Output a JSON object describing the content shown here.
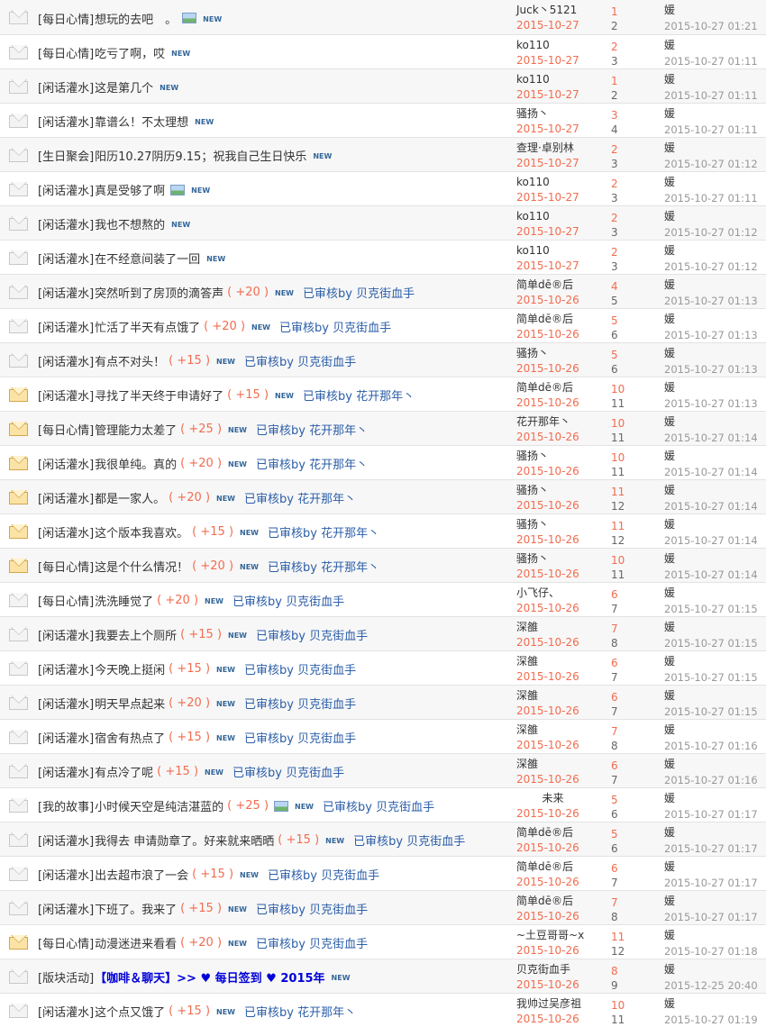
{
  "new_label": "NEW",
  "threads": [
    {
      "category": "[每日心情]",
      "subject": "想玩的去吧　。",
      "credit": "",
      "pic": true,
      "audit": "",
      "hot": false,
      "bold": false,
      "author": "Juck丶5121",
      "date": "2015-10-27",
      "replies": "1",
      "views": "2",
      "last_user": "媛",
      "last_time": "2015-10-27 01:21"
    },
    {
      "category": "[每日心情]",
      "subject": "吃亏了啊，哎",
      "credit": "",
      "pic": false,
      "audit": "",
      "hot": false,
      "bold": false,
      "author": "ko110",
      "date": "2015-10-27",
      "replies": "2",
      "views": "3",
      "last_user": "媛",
      "last_time": "2015-10-27 01:11"
    },
    {
      "category": "[闲话灌水]",
      "subject": "这是第几个",
      "credit": "",
      "pic": false,
      "audit": "",
      "hot": false,
      "bold": false,
      "author": "ko110",
      "date": "2015-10-27",
      "replies": "1",
      "views": "2",
      "last_user": "媛",
      "last_time": "2015-10-27 01:11"
    },
    {
      "category": "[闲话灌水]",
      "subject": "靠谱么！不太理想",
      "credit": "",
      "pic": false,
      "audit": "",
      "hot": false,
      "bold": false,
      "author": "骚扬丶",
      "date": "2015-10-27",
      "replies": "3",
      "views": "4",
      "last_user": "媛",
      "last_time": "2015-10-27 01:11"
    },
    {
      "category": "[生日聚会]",
      "subject": "阳历10.27阴历9.15；祝我自己生日快乐",
      "credit": "",
      "pic": false,
      "audit": "",
      "hot": false,
      "bold": false,
      "author": "查理·卓别林",
      "date": "2015-10-27",
      "replies": "2",
      "views": "3",
      "last_user": "媛",
      "last_time": "2015-10-27 01:12"
    },
    {
      "category": "[闲话灌水]",
      "subject": "真是受够了啊",
      "credit": "",
      "pic": true,
      "audit": "",
      "hot": false,
      "bold": false,
      "author": "ko110",
      "date": "2015-10-27",
      "replies": "2",
      "views": "3",
      "last_user": "媛",
      "last_time": "2015-10-27 01:11"
    },
    {
      "category": "[闲话灌水]",
      "subject": "我也不想熬的",
      "credit": "",
      "pic": false,
      "audit": "",
      "hot": false,
      "bold": false,
      "author": "ko110",
      "date": "2015-10-27",
      "replies": "2",
      "views": "3",
      "last_user": "媛",
      "last_time": "2015-10-27 01:12"
    },
    {
      "category": "[闲话灌水]",
      "subject": "在不经意间装了一回",
      "credit": "",
      "pic": false,
      "audit": "",
      "hot": false,
      "bold": false,
      "author": "ko110",
      "date": "2015-10-27",
      "replies": "2",
      "views": "3",
      "last_user": "媛",
      "last_time": "2015-10-27 01:12"
    },
    {
      "category": "[闲话灌水]",
      "subject": "突然听到了房顶的滴答声",
      "credit": "( +20 )",
      "pic": false,
      "audit": "已审核by 贝克街血手",
      "hot": false,
      "bold": false,
      "author": "简单dē®后",
      "date": "2015-10-26",
      "replies": "4",
      "views": "5",
      "last_user": "媛",
      "last_time": "2015-10-27 01:13"
    },
    {
      "category": "[闲话灌水]",
      "subject": "忙活了半天有点饿了",
      "credit": "( +20 )",
      "pic": false,
      "audit": "已审核by 贝克街血手",
      "hot": false,
      "bold": false,
      "author": "简单dē®后",
      "date": "2015-10-26",
      "replies": "5",
      "views": "6",
      "last_user": "媛",
      "last_time": "2015-10-27 01:13"
    },
    {
      "category": "[闲话灌水]",
      "subject": "有点不对头！",
      "credit": "( +15 )",
      "pic": false,
      "audit": "已审核by 贝克街血手",
      "hot": false,
      "bold": false,
      "author": "骚扬丶",
      "date": "2015-10-26",
      "replies": "5",
      "views": "6",
      "last_user": "媛",
      "last_time": "2015-10-27 01:13"
    },
    {
      "category": "[闲话灌水]",
      "subject": "寻找了半天终于申请好了",
      "credit": "( +15 )",
      "pic": false,
      "audit": "已审核by 花开那年丶",
      "hot": true,
      "bold": false,
      "author": "简单dē®后",
      "date": "2015-10-26",
      "replies": "10",
      "views": "11",
      "last_user": "媛",
      "last_time": "2015-10-27 01:13"
    },
    {
      "category": "[每日心情]",
      "subject": "管理能力太差了",
      "credit": "( +25 )",
      "pic": false,
      "audit": "已审核by 花开那年丶",
      "hot": true,
      "bold": false,
      "author": "花开那年丶",
      "date": "2015-10-26",
      "replies": "10",
      "views": "11",
      "last_user": "媛",
      "last_time": "2015-10-27 01:14"
    },
    {
      "category": "[闲话灌水]",
      "subject": "我很单纯。真的",
      "credit": "( +20 )",
      "pic": false,
      "audit": "已审核by 花开那年丶",
      "hot": true,
      "bold": false,
      "author": "骚扬丶",
      "date": "2015-10-26",
      "replies": "10",
      "views": "11",
      "last_user": "媛",
      "last_time": "2015-10-27 01:14"
    },
    {
      "category": "[闲话灌水]",
      "subject": "都是一家人。",
      "credit": "( +20 )",
      "pic": false,
      "audit": "已审核by 花开那年丶",
      "hot": true,
      "bold": false,
      "author": "骚扬丶",
      "date": "2015-10-26",
      "replies": "11",
      "views": "12",
      "last_user": "媛",
      "last_time": "2015-10-27 01:14"
    },
    {
      "category": "[闲话灌水]",
      "subject": "这个版本我喜欢。",
      "credit": "( +15 )",
      "pic": false,
      "audit": "已审核by 花开那年丶",
      "hot": true,
      "bold": false,
      "author": "骚扬丶",
      "date": "2015-10-26",
      "replies": "11",
      "views": "12",
      "last_user": "媛",
      "last_time": "2015-10-27 01:14"
    },
    {
      "category": "[每日心情]",
      "subject": "这是个什么情况！",
      "credit": "( +20 )",
      "pic": false,
      "audit": "已审核by 花开那年丶",
      "hot": true,
      "bold": false,
      "author": "骚扬丶",
      "date": "2015-10-26",
      "replies": "10",
      "views": "11",
      "last_user": "媛",
      "last_time": "2015-10-27 01:14"
    },
    {
      "category": "[每日心情]",
      "subject": "洗洗睡觉了",
      "credit": "( +20 )",
      "pic": false,
      "audit": "已审核by 贝克街血手",
      "hot": false,
      "bold": false,
      "author": "小飞仔、",
      "date": "2015-10-26",
      "replies": "6",
      "views": "7",
      "last_user": "媛",
      "last_time": "2015-10-27 01:15"
    },
    {
      "category": "[闲话灌水]",
      "subject": "我要去上个厕所",
      "credit": "( +15 )",
      "pic": false,
      "audit": "已审核by 贝克街血手",
      "hot": false,
      "bold": false,
      "author": "深雒",
      "date": "2015-10-26",
      "replies": "7",
      "views": "8",
      "last_user": "媛",
      "last_time": "2015-10-27 01:15"
    },
    {
      "category": "[闲话灌水]",
      "subject": "今天晚上挺闲",
      "credit": "( +15 )",
      "pic": false,
      "audit": "已审核by 贝克街血手",
      "hot": false,
      "bold": false,
      "author": "深雒",
      "date": "2015-10-26",
      "replies": "6",
      "views": "7",
      "last_user": "媛",
      "last_time": "2015-10-27 01:15"
    },
    {
      "category": "[闲话灌水]",
      "subject": "明天早点起来",
      "credit": "( +20 )",
      "pic": false,
      "audit": "已审核by 贝克街血手",
      "hot": false,
      "bold": false,
      "author": "深雒",
      "date": "2015-10-26",
      "replies": "6",
      "views": "7",
      "last_user": "媛",
      "last_time": "2015-10-27 01:15"
    },
    {
      "category": "[闲话灌水]",
      "subject": "宿舍有热点了",
      "credit": "( +15 )",
      "pic": false,
      "audit": "已审核by 贝克街血手",
      "hot": false,
      "bold": false,
      "author": "深雒",
      "date": "2015-10-26",
      "replies": "7",
      "views": "8",
      "last_user": "媛",
      "last_time": "2015-10-27 01:16"
    },
    {
      "category": "[闲话灌水]",
      "subject": "有点冷了呢",
      "credit": "( +15 )",
      "pic": false,
      "audit": "已审核by 贝克街血手",
      "hot": false,
      "bold": false,
      "author": "深雒",
      "date": "2015-10-26",
      "replies": "6",
      "views": "7",
      "last_user": "媛",
      "last_time": "2015-10-27 01:16"
    },
    {
      "category": "[我的故事]",
      "subject": "小时候天空是纯洁湛蓝的",
      "credit": "( +25 )",
      "pic": true,
      "audit": "已审核by 贝克街血手",
      "hot": false,
      "bold": false,
      "author": "未来",
      "author_center": true,
      "date": "2015-10-26",
      "replies": "5",
      "views": "6",
      "last_user": "媛",
      "last_time": "2015-10-27 01:17"
    },
    {
      "category": "[闲话灌水]",
      "subject": "我得去 申请勋章了。好来就来晒晒",
      "credit": "( +15 )",
      "pic": false,
      "audit": "已审核by 贝克街血手",
      "hot": false,
      "bold": false,
      "author": "简单dē®后",
      "date": "2015-10-26",
      "replies": "5",
      "views": "6",
      "last_user": "媛",
      "last_time": "2015-10-27 01:17"
    },
    {
      "category": "[闲话灌水]",
      "subject": "出去超市浪了一会",
      "credit": "( +15 )",
      "pic": false,
      "audit": "已审核by 贝克街血手",
      "hot": false,
      "bold": false,
      "author": "简单dē®后",
      "date": "2015-10-26",
      "replies": "6",
      "views": "7",
      "last_user": "媛",
      "last_time": "2015-10-27 01:17"
    },
    {
      "category": "[闲话灌水]",
      "subject": "下班了。我来了",
      "credit": "( +15 )",
      "pic": false,
      "audit": "已审核by 贝克街血手",
      "hot": false,
      "bold": false,
      "author": "简单dē®后",
      "date": "2015-10-26",
      "replies": "7",
      "views": "8",
      "last_user": "媛",
      "last_time": "2015-10-27 01:17"
    },
    {
      "category": "[每日心情]",
      "subject": "动漫迷进来看看",
      "credit": "( +20 )",
      "pic": false,
      "audit": "已审核by 贝克街血手",
      "hot": true,
      "bold": false,
      "author": "~土豆哥哥~x",
      "date": "2015-10-26",
      "replies": "11",
      "views": "12",
      "last_user": "媛",
      "last_time": "2015-10-27 01:18"
    },
    {
      "category": "[版块活动]",
      "subject": "【咖啡＆聊天】>> ♥ 每日签到 ♥ 2015年",
      "credit": "",
      "pic": false,
      "audit": "",
      "hot": false,
      "bold": true,
      "author": "贝克街血手",
      "date": "2015-10-26",
      "replies": "8",
      "views": "9",
      "last_user": "媛",
      "last_time": "2015-12-25 20:40"
    },
    {
      "category": "[闲话灌水]",
      "subject": "这个点又饿了",
      "credit": "( +15 )",
      "pic": false,
      "audit": "已审核by 花开那年丶",
      "hot": false,
      "bold": false,
      "author": "我帅过吴彦祖",
      "date": "2015-10-26",
      "replies": "10",
      "views": "11",
      "last_user": "媛",
      "last_time": "2015-10-27 01:19"
    }
  ]
}
